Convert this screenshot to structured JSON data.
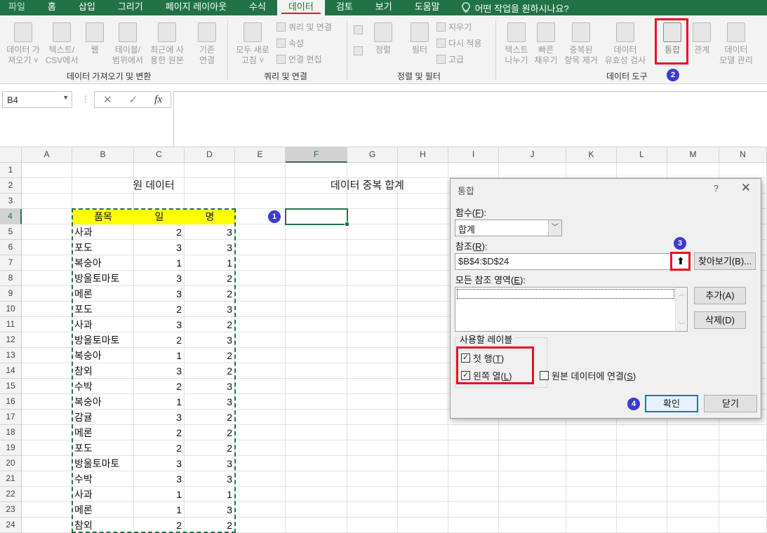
{
  "menubar": {
    "tabs": [
      "파일",
      "홈",
      "삽입",
      "그리기",
      "페이지 레이아웃",
      "수식",
      "데이터",
      "검토",
      "보기",
      "도움말"
    ],
    "active_index": 6,
    "tell_me": "어떤 작업을 원하시나요?"
  },
  "ribbon": {
    "get_data": {
      "label": "데이터 가져오기 및 변환",
      "buttons": [
        "데이터 가\n져오기 ˅",
        "텍스트/\nCSV에서",
        "웹",
        "테이블/\n범위에서",
        "최근에 사\n용한 원본",
        "기존\n연결"
      ]
    },
    "queries": {
      "label": "쿼리 및 연결",
      "refresh": "모두 새로\n고침 ˅",
      "small": [
        "쿼리 및 연결",
        "속성",
        "연결 편집"
      ]
    },
    "sort": {
      "label": "정렬 및 필터",
      "sort": "정렬",
      "filter": "필터",
      "small": [
        "지우기",
        "다시 적용",
        "고급"
      ]
    },
    "tools": {
      "label": "데이터 도구",
      "buttons": [
        "텍스트\n나누기",
        "빠른\n채우기",
        "중복된\n항목 제거",
        "데이터\n유효성 검사",
        "통합",
        "관계",
        "데이터\n모델 관리"
      ]
    },
    "badge2": "2"
  },
  "formula_bar": {
    "name_box": "B4",
    "cancel": "✕",
    "enter": "✓",
    "fx": "fx",
    "value": ""
  },
  "grid": {
    "columns": [
      "A",
      "B",
      "C",
      "D",
      "E",
      "F",
      "G",
      "H",
      "I",
      "J",
      "K",
      "L",
      "M",
      "N"
    ],
    "rows": [
      "1",
      "2",
      "3",
      "4",
      "5",
      "6",
      "7",
      "8",
      "9",
      "10",
      "11",
      "12",
      "13",
      "14",
      "15",
      "16",
      "17",
      "18",
      "19",
      "20",
      "21",
      "22",
      "23",
      "24"
    ],
    "title_left": "원 데이터",
    "title_right": "데이터 중복 합계",
    "headers": [
      "품목",
      "일",
      "명"
    ],
    "data": [
      [
        "사과",
        2,
        3
      ],
      [
        "포도",
        3,
        3
      ],
      [
        "복숭아",
        1,
        1
      ],
      [
        "방울토마토",
        3,
        2
      ],
      [
        "메론",
        3,
        2
      ],
      [
        "포도",
        2,
        3
      ],
      [
        "사과",
        3,
        2
      ],
      [
        "방울토마토",
        2,
        3
      ],
      [
        "복숭아",
        1,
        2
      ],
      [
        "참외",
        3,
        2
      ],
      [
        "수박",
        2,
        3
      ],
      [
        "복숭아",
        1,
        3
      ],
      [
        "감귤",
        3,
        2
      ],
      [
        "메론",
        2,
        2
      ],
      [
        "포도",
        2,
        2
      ],
      [
        "방울토마토",
        3,
        3
      ],
      [
        "수박",
        3,
        3
      ],
      [
        "사과",
        1,
        1
      ],
      [
        "메론",
        1,
        3
      ],
      [
        "참외",
        2,
        2
      ]
    ],
    "badge1": "1"
  },
  "dialog": {
    "title": "통합",
    "help": "?",
    "close": "✕",
    "function_label": "함수(",
    "function_key": "F",
    "function_selected": "합계",
    "reference_label": "참조(",
    "reference_key": "R",
    "reference_value": "$B$4:$D$24",
    "collapse_icon": "⬆",
    "browse_button": "찾아보기(B)...",
    "all_refs_label": "모든 참조 영역(",
    "all_refs_key": "E",
    "add_button": "추가(A)",
    "delete_button": "삭제(D)",
    "labels_group": "사용할 레이블",
    "top_row": "첫 행(",
    "top_row_key": "T",
    "left_column": "왼쪽 열(",
    "left_column_key": "L",
    "link_source": "원본 데이터에 연결(",
    "link_source_key": "S",
    "ok_button": "확인",
    "close_button": "닫기",
    "badge3": "3",
    "badge4": "4",
    "check_mark": "✓"
  }
}
